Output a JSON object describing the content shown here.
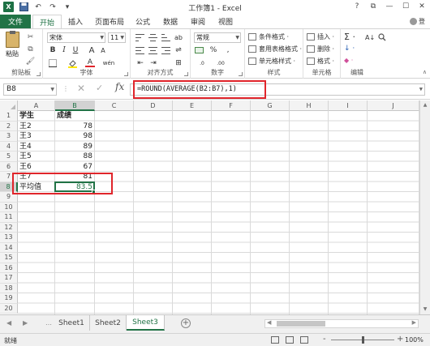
{
  "window": {
    "title": "工作簿1 - Excel",
    "controls": [
      "?",
      "⧉",
      "—",
      "☐",
      "✕"
    ],
    "signin": "登"
  },
  "quick_access": [
    "save-icon",
    "undo-icon",
    "redo-icon",
    "customize-icon"
  ],
  "tabs": {
    "file": "文件",
    "items": [
      "开始",
      "插入",
      "页面布局",
      "公式",
      "数据",
      "审阅",
      "视图"
    ],
    "active": "开始"
  },
  "ribbon": {
    "clipboard": {
      "label": "剪贴板",
      "paste": "粘贴"
    },
    "font": {
      "label": "字体",
      "font_name": "宋体",
      "font_size": "11",
      "bold": "B",
      "italic": "I",
      "underline": "U",
      "grow": "A",
      "shrink": "A",
      "color_a": "A",
      "phonetic": "wén"
    },
    "alignment": {
      "label": "对齐方式"
    },
    "number": {
      "label": "数字",
      "format": "常规",
      "percent": "%",
      "comma": ",",
      "inc": ".0",
      "dec": ".00"
    },
    "styles": {
      "label": "样式",
      "items": [
        "条件格式 ·",
        "套用表格格式 ·",
        "单元格样式 ·"
      ]
    },
    "cells": {
      "label": "单元格",
      "items": [
        "插入 ·",
        "删除 ·",
        "格式 ·"
      ]
    },
    "editing": {
      "label": "编辑",
      "sum": "Σ ·",
      "fill": "↓ ·",
      "clear": "◆ ·",
      "sort": "A↓",
      "find": "🔍"
    }
  },
  "formula_bar": {
    "name_box": "B8",
    "formula": "=ROUND(AVERAGE(B2:B7),1)",
    "fx": "fx"
  },
  "grid": {
    "columns": [
      "A",
      "B",
      "C",
      "D",
      "E",
      "F",
      "G",
      "H",
      "I",
      "J"
    ],
    "selected_column": "B",
    "rows": [
      "1",
      "2",
      "3",
      "4",
      "5",
      "6",
      "7",
      "8",
      "9",
      "10",
      "11",
      "12",
      "13",
      "14",
      "15",
      "16",
      "17",
      "18",
      "19",
      "20"
    ],
    "selected_row": "8",
    "cells": {
      "A1": "学生",
      "B1": "成绩",
      "A2": "王2",
      "B2": "78",
      "A3": "王3",
      "B3": "98",
      "A4": "王4",
      "B4": "89",
      "A5": "王5",
      "B5": "88",
      "A6": "王6",
      "B6": "67",
      "A7": "王7",
      "B7": "81",
      "A8": "平均值",
      "B8": "83.5"
    }
  },
  "sheets": {
    "tabs": [
      "Sheet1",
      "Sheet2",
      "Sheet3"
    ],
    "active": "Sheet3",
    "add": "+"
  },
  "status": {
    "text": "就绪",
    "zoom_minus": "-",
    "zoom_plus": "+",
    "zoom": "100%"
  },
  "colors": {
    "accent": "#217346",
    "highlight": "#e0252b"
  }
}
